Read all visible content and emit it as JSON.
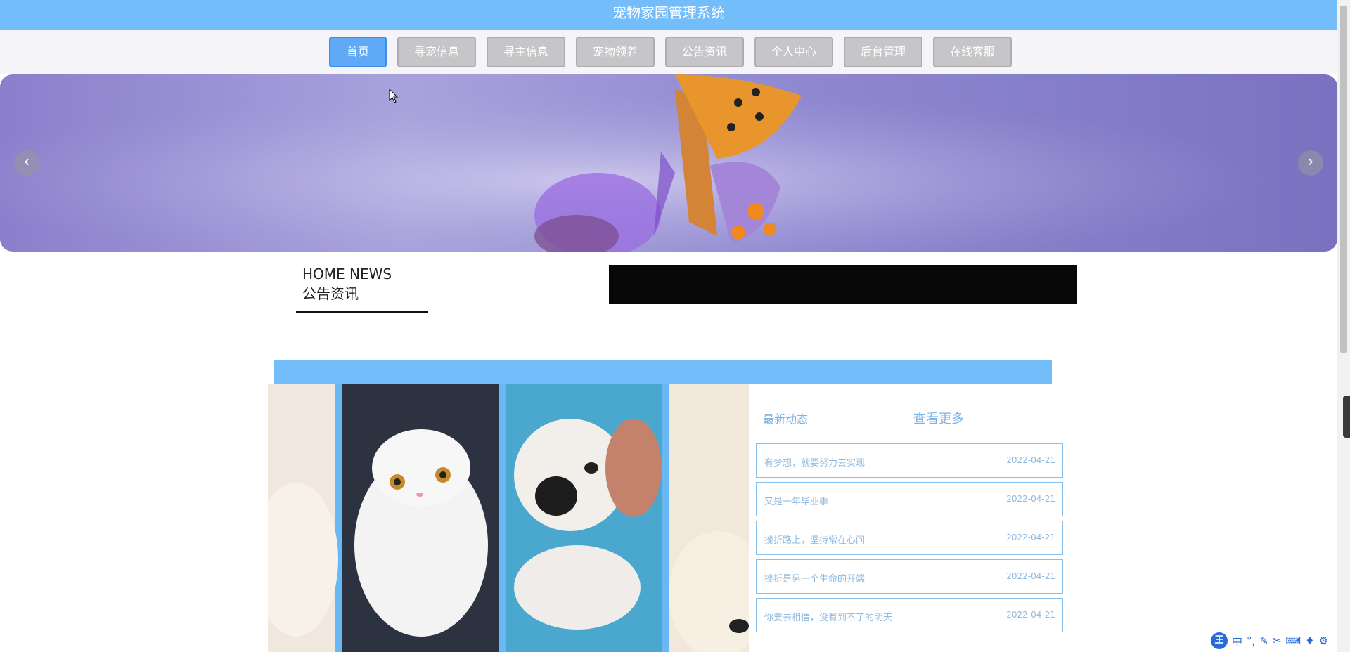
{
  "header": {
    "title": "宠物家园管理系统"
  },
  "nav": {
    "items": [
      {
        "label": "首页",
        "active": true
      },
      {
        "label": "寻宠信息"
      },
      {
        "label": "寻主信息"
      },
      {
        "label": "宠物领养"
      },
      {
        "label": "公告资讯"
      },
      {
        "label": "个人中心"
      },
      {
        "label": "后台管理"
      },
      {
        "label": "在线客服"
      }
    ]
  },
  "carousel": {
    "prev_icon": "chevron-left-icon",
    "next_icon": "chevron-right-icon",
    "prev_glyph": "‹",
    "next_glyph": "›"
  },
  "news_section": {
    "title_en": "HOME NEWS",
    "title_cn": "公告资讯"
  },
  "latest": {
    "title": "最新动态",
    "more": "查看更多",
    "items": [
      {
        "title": "有梦想，就要努力去实现",
        "date": "2022-04-21"
      },
      {
        "title": "又是一年毕业季",
        "date": "2022-04-21"
      },
      {
        "title": "挫折路上，坚持常在心间",
        "date": "2022-04-21"
      },
      {
        "title": "挫折是另一个生命的开端",
        "date": "2022-04-21"
      },
      {
        "title": "你要去相信，没有到不了的明天",
        "date": "2022-04-21"
      }
    ]
  },
  "tray": {
    "logo": "王",
    "lang": "中",
    "icons": [
      "punctuation-icon",
      "pen-icon",
      "scissors-icon",
      "keyboard-icon",
      "shirt-icon",
      "gear-icon"
    ]
  },
  "colors": {
    "primary": "#74bdfb",
    "nav_inactive": "#c6c6c9",
    "nav_active": "#5fa9f6",
    "text_link": "#7db3e6"
  }
}
